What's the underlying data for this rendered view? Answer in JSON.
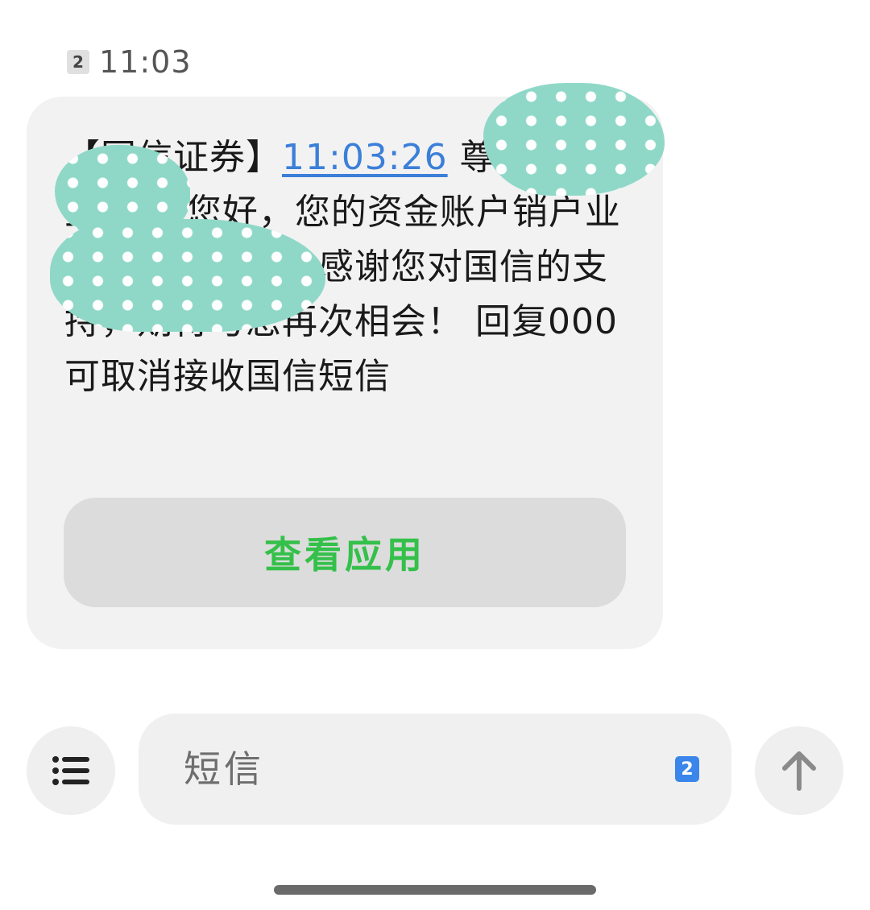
{
  "header": {
    "sim_number": "2",
    "time": "11:03"
  },
  "message": {
    "text_before_link": "【国信证券】",
    "link_time": "11:03:26",
    "text_after_link": " 尊敬的先生/女士您好，您的资金账户销户业务已办理成功。感谢您对国信的支持，期待与您再次相会！ 回复000可取消接收国信短信",
    "action_button_label": "查看应用"
  },
  "composer": {
    "placeholder": "短信",
    "sim_indicator": "2"
  },
  "colors": {
    "link": "#3b7fd9",
    "action_button_text": "#34c04a",
    "sim_indicator": "#3a86ea",
    "bubble_background": "#f2f2f2",
    "redaction": "#8fd8c8"
  },
  "icons": {
    "menu": "list-icon",
    "send": "arrow-up-icon"
  }
}
